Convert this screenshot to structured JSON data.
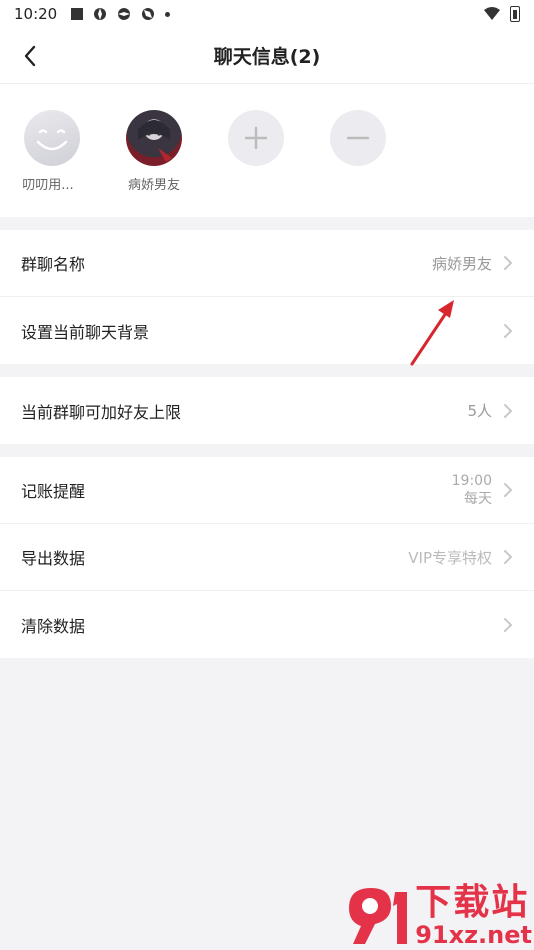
{
  "status_bar": {
    "time": "10:20"
  },
  "nav": {
    "title": "聊天信息(2)"
  },
  "members": [
    {
      "name": "叨叨用...",
      "avatar": "smile-face-avatar"
    },
    {
      "name": "病娇男友",
      "avatar": "anime-avatar"
    }
  ],
  "settings": {
    "group1": [
      {
        "label": "群聊名称",
        "value": "病娇男友"
      },
      {
        "label": "设置当前聊天背景",
        "value": ""
      }
    ],
    "group2": [
      {
        "label": "当前群聊可加好友上限",
        "value": "5人"
      }
    ],
    "group3": [
      {
        "label": "记账提醒",
        "value_line1": "19:00",
        "value_line2": "每天"
      },
      {
        "label": "导出数据",
        "value": "VIP专享特权"
      },
      {
        "label": "清除数据",
        "value": ""
      }
    ]
  },
  "watermark": {
    "big": "下载站",
    "small": "91xz.net"
  },
  "colors": {
    "accent_red": "#e3233b",
    "background": "#f3f3f6"
  }
}
